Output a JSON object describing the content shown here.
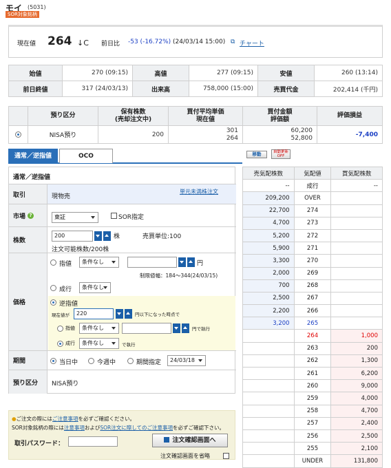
{
  "stock": {
    "name": "モイ",
    "code": "(5031)",
    "badge": "SOR対象銘柄"
  },
  "price": {
    "label": "現在値",
    "value": "264",
    "mark": "↓C",
    "change_label": "前日比",
    "change": "-53 (-16.72%)",
    "time": "(24/03/14 15:00)",
    "chart_link": "チャート"
  },
  "summary": [
    [
      "始値",
      "270",
      "(09:15)",
      "高値",
      "277",
      "(09:15)",
      "安値",
      "260",
      "(13:14)"
    ],
    [
      "前日終値",
      "317",
      "(24/03/13)",
      "出来高",
      "758,000",
      "(15:00)",
      "売買代金",
      "202,414",
      "(千円)"
    ]
  ],
  "holdings": {
    "headers": [
      "預り区分",
      "保有株数\n(売却注文中)",
      "買付平均単価\n現在値",
      "買付金額\n評価額",
      "評価損益"
    ],
    "row": {
      "account": "NISA預り",
      "shares": "200",
      "avg_price": "301",
      "current": "264",
      "buy_amount": "60,200",
      "valuation": "52,800",
      "pnl": "-7,400"
    }
  },
  "tabs": {
    "active": "通常／逆指値",
    "other": "OCO"
  },
  "buttons": {
    "move": "移動",
    "auto_update": "自動更新 OFF",
    "confirm": "注文確認画面へ"
  },
  "form": {
    "section_title": "通常／逆指値",
    "torihiki": {
      "label": "取引",
      "value": "現物売",
      "link": "単元未満株注文"
    },
    "market": {
      "label": "市場",
      "select": "東証",
      "sor": "SOR指定"
    },
    "shares": {
      "label": "株数",
      "value": "200",
      "unit": "株",
      "trade_unit": "売買単位:100",
      "available": "注文可能株数/200株"
    },
    "price": {
      "label": "価格",
      "limit": "指値",
      "cond_none": "条件なし",
      "yen": "円",
      "limit_range": "制限値幅：184～344(24/03/15)",
      "market": "成行",
      "stop": "逆指値",
      "current_price_label": "現在値が",
      "stop_value": "220",
      "stop_suffix": "円以下になった時点で",
      "sub_limit": "指値",
      "sub_exec": "円で執行",
      "sub_market": "成行",
      "exec": "で執行"
    },
    "period": {
      "label": "期間",
      "today": "当日中",
      "week": "今週中",
      "date_label": "期間指定",
      "date": "24/03/18"
    },
    "account": {
      "label": "預り区分",
      "value": "NISA預り"
    }
  },
  "notice": {
    "line1_pre": "ご注文の際には",
    "line1_link": "ご注意事項",
    "line1_post": "を必ずご確認ください。",
    "line2_pre": "SOR対象銘柄の際には",
    "line2_link1": "注意事項",
    "line2_mid": "および",
    "line2_link2": "SOR注文に際してのご注意事項",
    "line2_post": "を必ずご確認下さい。",
    "password_label": "取引パスワード：",
    "skip": "注文確認画面を省略"
  },
  "orderbook": {
    "headers": [
      "売気配株数",
      "気配値",
      "買気配株数"
    ],
    "rows": [
      {
        "sell": "--",
        "price": "成行",
        "buy": "--"
      },
      {
        "sell": "209,200",
        "price": "OVER",
        "buy": ""
      },
      {
        "sell": "22,700",
        "price": "274",
        "buy": ""
      },
      {
        "sell": "4,700",
        "price": "273",
        "buy": ""
      },
      {
        "sell": "5,200",
        "price": "272",
        "buy": ""
      },
      {
        "sell": "5,900",
        "price": "271",
        "buy": ""
      },
      {
        "sell": "3,300",
        "price": "270",
        "buy": ""
      },
      {
        "sell": "2,000",
        "price": "269",
        "buy": ""
      },
      {
        "sell": "700",
        "price": "268",
        "buy": ""
      },
      {
        "sell": "2,500",
        "price": "267",
        "buy": ""
      },
      {
        "sell": "2,200",
        "price": "266",
        "buy": ""
      },
      {
        "sell": "3,200",
        "price": "265",
        "buy": ""
      },
      {
        "sell": "",
        "price": "264",
        "buy": "1,000"
      },
      {
        "sell": "",
        "price": "263",
        "buy": "200"
      },
      {
        "sell": "",
        "price": "262",
        "buy": "1,300"
      },
      {
        "sell": "",
        "price": "261",
        "buy": "6,200"
      },
      {
        "sell": "",
        "price": "260",
        "buy": "9,000"
      },
      {
        "sell": "",
        "price": "259",
        "buy": "4,000"
      },
      {
        "sell": "",
        "price": "258",
        "buy": "4,700"
      },
      {
        "sell": "",
        "price": "257",
        "buy": "2,400"
      },
      {
        "sell": "",
        "price": "256",
        "buy": "2,500"
      },
      {
        "sell": "",
        "price": "255",
        "buy": "2,100"
      },
      {
        "sell": "",
        "price": "UNDER",
        "buy": "131,800"
      }
    ]
  },
  "colors": {
    "accent": "#2a6fb8",
    "negative": "#1b3fc4",
    "up": "#e00000",
    "badge": "#e66b2f"
  }
}
